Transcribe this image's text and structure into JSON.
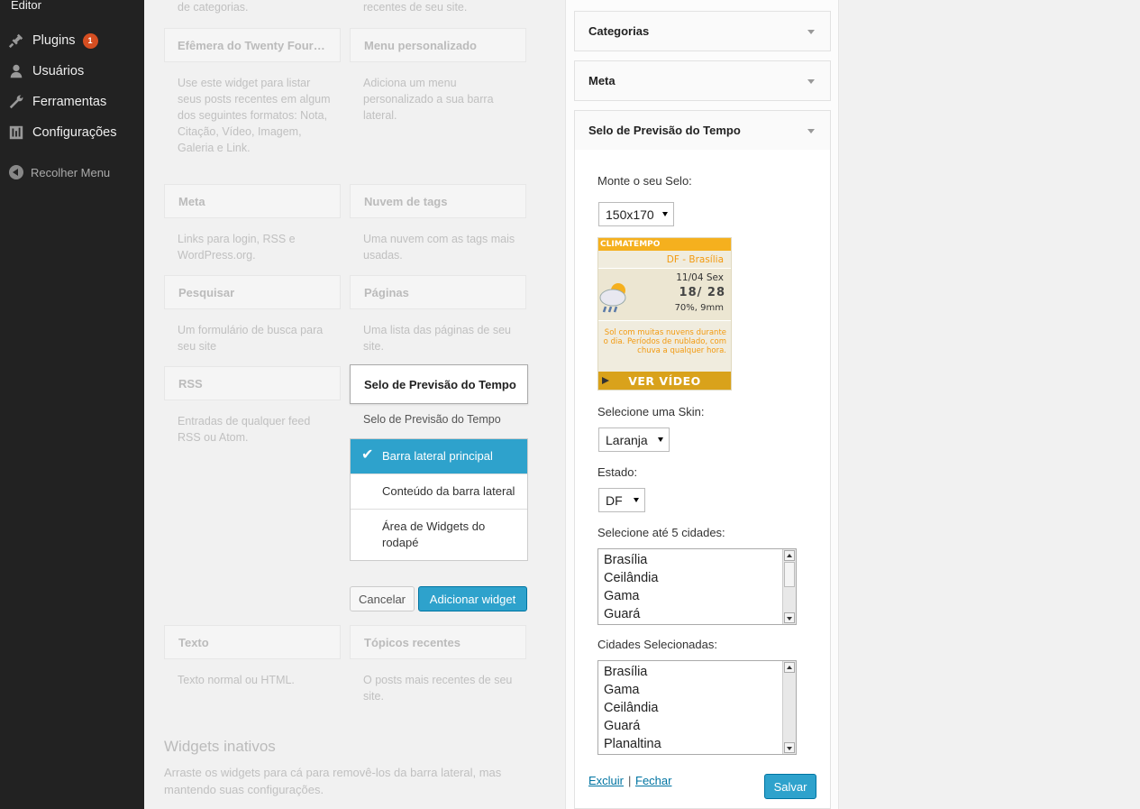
{
  "admin_menu": {
    "editor_label": "Editor",
    "items": [
      {
        "label": "Plugins",
        "icon": "plugin-icon",
        "badge": "1"
      },
      {
        "label": "Usuários",
        "icon": "users-icon"
      },
      {
        "label": "Ferramentas",
        "icon": "wrench-icon"
      },
      {
        "label": "Configurações",
        "icon": "settings-icon"
      }
    ],
    "collapse_label": "Recolher Menu"
  },
  "available_widgets": {
    "col1_top_desc": "de categorias.",
    "col2_top_desc": "recentes de seu site.",
    "items": [
      {
        "title": "Efêmera do Twenty Four…",
        "desc": "Use este widget para listar seus posts recentes em algum dos seguintes formatos: Nota, Citação, Vídeo, Imagem, Galeria e Link."
      },
      {
        "title": "Menu personalizado",
        "desc": "Adiciona um menu personalizado a sua barra lateral."
      },
      {
        "title": "Meta",
        "desc": "Links para login, RSS e WordPress.org."
      },
      {
        "title": "Nuvem de tags",
        "desc": "Uma nuvem com as tags mais usadas."
      },
      {
        "title": "Pesquisar",
        "desc": "Um formulário de busca para seu site"
      },
      {
        "title": "Páginas",
        "desc": "Uma lista das páginas de seu site."
      },
      {
        "title": "RSS",
        "desc": "Entradas de qualquer feed RSS ou Atom."
      },
      {
        "title": "Texto",
        "desc": "Texto normal ou HTML."
      },
      {
        "title": "Tópicos recentes",
        "desc": "O posts mais recentes de seu site."
      }
    ]
  },
  "chooser": {
    "widget_title": "Selo de Previsão do Tempo",
    "widget_desc": "Selo de Previsão do Tempo",
    "areas": [
      "Barra lateral principal",
      "Conteúdo da barra lateral",
      "Área de Widgets do rodapé"
    ],
    "cancel_label": "Cancelar",
    "add_label": "Adicionar widget"
  },
  "inactive": {
    "title": "Widgets inativos",
    "desc": "Arraste os widgets para cá para removê-los da barra lateral, mas mantendo suas configurações."
  },
  "sidebar_widgets": {
    "categorias": "Categorias",
    "meta": "Meta",
    "selo": "Selo de Previsão do Tempo"
  },
  "selo_form": {
    "monte_label": "Monte o seu Selo:",
    "size_value": "150x170",
    "skin_label": "Selecione uma Skin:",
    "skin_value": "Laranja",
    "estado_label": "Estado:",
    "estado_value": "DF",
    "cities_label": "Selecione até 5 cidades:",
    "cities": [
      "Brasília",
      "Ceilândia",
      "Gama",
      "Guará"
    ],
    "selected_label": "Cidades Selecionadas:",
    "selected_cities": [
      "Brasília",
      "Gama",
      "Ceilândia",
      "Guará",
      "Planaltina"
    ],
    "delete_label": "Excluir",
    "separator": "|",
    "close_label": "Fechar",
    "save_label": "Salvar"
  },
  "weather_badge": {
    "brand": "CLIMATEMPO",
    "city": "DF - Brasília",
    "date": "11/04 Sex",
    "temp": "18/   28",
    "humidity": "70%, 9mm",
    "forecast": "Sol com muitas nuvens durante o dia. Períodos de nublado, com chuva a qualquer hora.",
    "video_label": "VER VÍDEO"
  },
  "colors": {
    "admin_bg": "#222222",
    "accent": "#2ea2cc",
    "badge": "#d54e21",
    "weather_orange": "#f5b01e"
  }
}
